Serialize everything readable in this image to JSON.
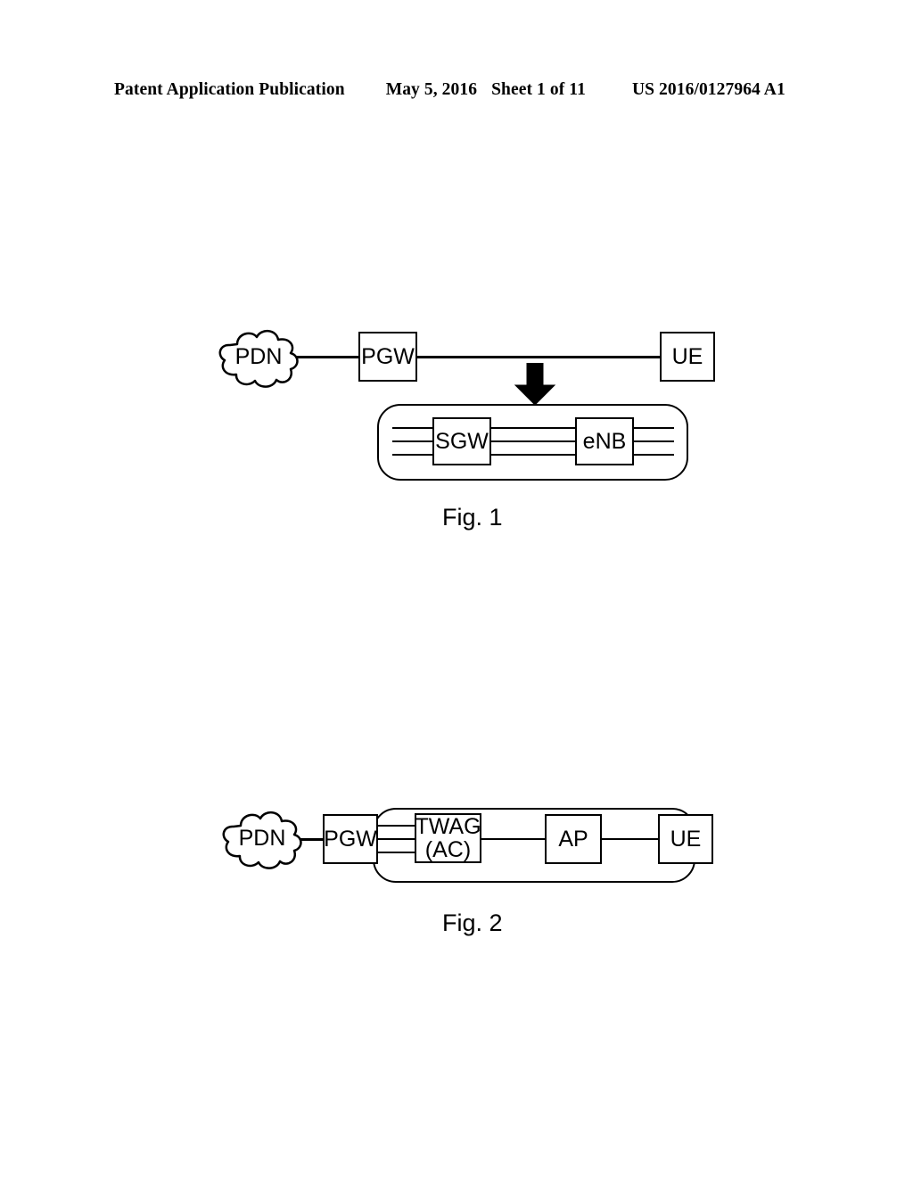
{
  "header": {
    "publication": "Patent Application Publication",
    "date": "May 5, 2016",
    "sheet": "Sheet 1 of 11",
    "patent_number": "US 2016/0127964 A1"
  },
  "figures": [
    {
      "caption": "Fig. 1",
      "nodes": {
        "pdn": "PDN",
        "pgw": "PGW",
        "ue": "UE",
        "sgw": "SGW",
        "enb": "eNB"
      },
      "annotations": {
        "arrow": "down-arrow",
        "grouping": "rounded-rectangle-group"
      }
    },
    {
      "caption": "Fig. 2",
      "nodes": {
        "pdn": "PDN",
        "pgw": "PGW",
        "twag_line1": "TWAG",
        "twag_line2": "(AC)",
        "ap": "AP",
        "ue": "UE"
      },
      "annotations": {
        "grouping": "rounded-rectangle-group"
      }
    }
  ],
  "colors": {
    "ink": "#000000",
    "paper": "#ffffff"
  }
}
